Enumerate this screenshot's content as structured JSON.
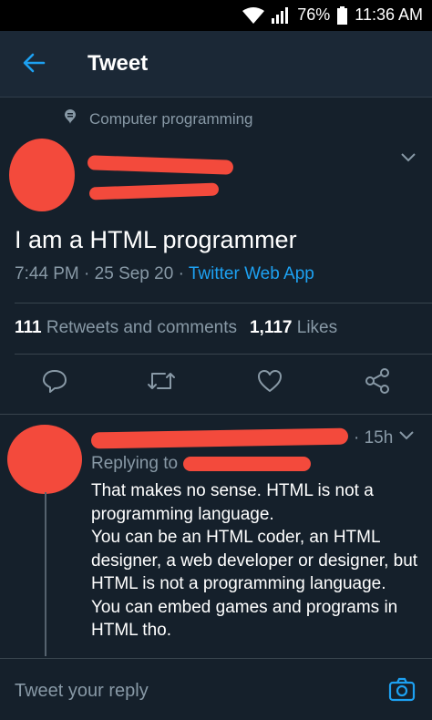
{
  "status_bar": {
    "battery": "76%",
    "time": "11:36 AM"
  },
  "header": {
    "title": "Tweet"
  },
  "tweet": {
    "topic": "Computer programming",
    "text": "I am a HTML programmer",
    "time": "7:44 PM",
    "date": "25 Sep 20",
    "source": "Twitter Web App",
    "retweets_count": "111",
    "retweets_label": "Retweets and comments",
    "likes_count": "1,117",
    "likes_label": "Likes"
  },
  "reply": {
    "time": "· 15h",
    "replying_to": "Replying to",
    "lines": [
      "That makes no sense. HTML is not a programming language.",
      "You can be an HTML coder, an HTML designer, a web developer or designer, but HTML is not a programming language.",
      "You can embed games and programs in HTML tho."
    ]
  },
  "composer": {
    "placeholder": "Tweet your reply"
  },
  "colors": {
    "background": "#15202b",
    "accent": "#1da1f2",
    "secondary_text": "#8899a6",
    "redaction": "#f34a3c"
  },
  "icons": [
    "wifi-icon",
    "signal-icon",
    "battery-icon",
    "back-arrow-icon",
    "topic-icon",
    "chevron-down-icon",
    "reply-icon",
    "retweet-icon",
    "like-icon",
    "share-icon",
    "camera-icon"
  ]
}
